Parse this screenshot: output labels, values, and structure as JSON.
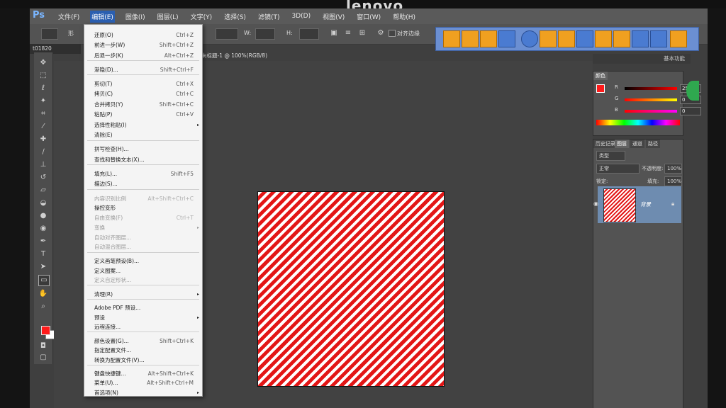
{
  "monitor": {
    "brand": "lenovo"
  },
  "app": {
    "logo": "Ps"
  },
  "menubar": {
    "items": [
      "文件(F)",
      "编辑(E)",
      "图像(I)",
      "图层(L)",
      "文字(Y)",
      "选择(S)",
      "滤镜(T)",
      "3D(D)",
      "视图(V)",
      "窗口(W)",
      "帮助(H)"
    ]
  },
  "optbar": {
    "w_label": "W:",
    "h_label": "H:",
    "align_label": "对齐边缘",
    "left_text": "形"
  },
  "doc": {
    "left_tab": "t01820",
    "tab_title": "未标题-1 @ 100%(RGB/8)"
  },
  "edit_menu": {
    "items": [
      {
        "label": "还原(O)",
        "shortcut": "Ctrl+Z",
        "disabled": false
      },
      {
        "label": "前进一步(W)",
        "shortcut": "Shift+Ctrl+Z",
        "disabled": false
      },
      {
        "label": "后退一步(K)",
        "shortcut": "Alt+Ctrl+Z",
        "disabled": false
      },
      {
        "label": "渐隐(D)...",
        "shortcut": "Shift+Ctrl+F",
        "disabled": false
      },
      {
        "label": "剪切(T)",
        "shortcut": "Ctrl+X",
        "disabled": false
      },
      {
        "label": "拷贝(C)",
        "shortcut": "Ctrl+C",
        "disabled": false
      },
      {
        "label": "合并拷贝(Y)",
        "shortcut": "Shift+Ctrl+C",
        "disabled": false
      },
      {
        "label": "粘贴(P)",
        "shortcut": "Ctrl+V",
        "disabled": false
      },
      {
        "label": "选择性粘贴(I)",
        "shortcut": "",
        "disabled": false,
        "submenu": true
      },
      {
        "label": "清除(E)",
        "shortcut": "",
        "disabled": false
      },
      {
        "label": "拼写检查(H)...",
        "shortcut": "",
        "disabled": false
      },
      {
        "label": "查找和替换文本(X)...",
        "shortcut": "",
        "disabled": false
      },
      {
        "label": "填充(L)...",
        "shortcut": "Shift+F5",
        "disabled": false
      },
      {
        "label": "描边(S)...",
        "shortcut": "",
        "disabled": false
      },
      {
        "label": "内容识别比例",
        "shortcut": "Alt+Shift+Ctrl+C",
        "disabled": true
      },
      {
        "label": "操控变形",
        "shortcut": "",
        "disabled": false
      },
      {
        "label": "自由变换(F)",
        "shortcut": "Ctrl+T",
        "disabled": true
      },
      {
        "label": "变换",
        "shortcut": "",
        "disabled": true,
        "submenu": true
      },
      {
        "label": "自动对齐图层...",
        "shortcut": "",
        "disabled": true
      },
      {
        "label": "自动混合图层...",
        "shortcut": "",
        "disabled": true
      },
      {
        "label": "定义画笔预设(B)...",
        "shortcut": "",
        "disabled": false
      },
      {
        "label": "定义图案...",
        "shortcut": "",
        "disabled": false
      },
      {
        "label": "定义自定形状...",
        "shortcut": "",
        "disabled": true
      },
      {
        "label": "清理(R)",
        "shortcut": "",
        "disabled": false,
        "submenu": true
      },
      {
        "label": "Adobe PDF 预设...",
        "shortcut": "",
        "disabled": false
      },
      {
        "label": "预设",
        "shortcut": "",
        "disabled": false,
        "submenu": true
      },
      {
        "label": "远程连接...",
        "shortcut": "",
        "disabled": false
      },
      {
        "label": "颜色设置(G)...",
        "shortcut": "Shift+Ctrl+K",
        "disabled": false
      },
      {
        "label": "指定配置文件...",
        "shortcut": "",
        "disabled": false
      },
      {
        "label": "转换为配置文件(V)...",
        "shortcut": "",
        "disabled": false
      },
      {
        "label": "键盘快捷键...",
        "shortcut": "Alt+Shift+Ctrl+K",
        "disabled": false
      },
      {
        "label": "菜单(U)...",
        "shortcut": "Alt+Shift+Ctrl+M",
        "disabled": false
      },
      {
        "label": "首选项(N)",
        "shortcut": "",
        "disabled": false,
        "submenu": true
      }
    ]
  },
  "workspace": {
    "label": "基本功能"
  },
  "color_panel": {
    "tab": "颜色",
    "r_label": "R",
    "r_value": "255",
    "g_label": "G",
    "g_value": "0",
    "b_label": "B",
    "b_value": "0"
  },
  "layers_panel": {
    "tabs": [
      "历史记录",
      "图层",
      "通道",
      "路径"
    ],
    "kind_label": "类型",
    "blend_mode": "正常",
    "opacity_label": "不透明度:",
    "opacity_value": "100%",
    "lock_label": "锁定:",
    "fill_label": "填充:",
    "fill_value": "100%",
    "layer_name": "背景"
  },
  "colors": {
    "foreground": "#ff1a1a",
    "background": "#ffffff",
    "stripe_red": "#e31616",
    "menu_highlight": "#2b5fb0"
  }
}
